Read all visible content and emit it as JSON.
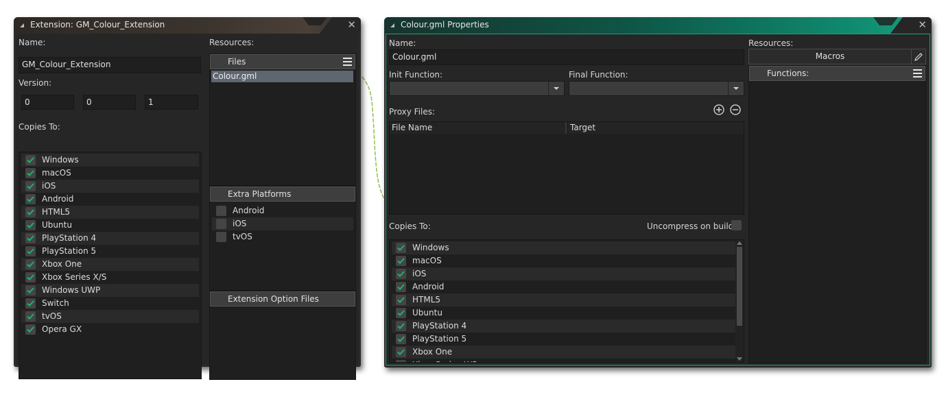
{
  "extension_window": {
    "title": "Extension: GM_Colour_Extension",
    "name_label": "Name:",
    "name_value": "GM_Colour_Extension",
    "version_label": "Version:",
    "version": [
      "0",
      "0",
      "1"
    ],
    "copies_to_label": "Copies To:",
    "copies_to": [
      {
        "label": "Windows",
        "checked": true
      },
      {
        "label": "macOS",
        "checked": true
      },
      {
        "label": "iOS",
        "checked": true
      },
      {
        "label": "Android",
        "checked": true
      },
      {
        "label": "HTML5",
        "checked": true
      },
      {
        "label": "Ubuntu",
        "checked": true
      },
      {
        "label": "PlayStation 4",
        "checked": true
      },
      {
        "label": "PlayStation 5",
        "checked": true
      },
      {
        "label": "Xbox One",
        "checked": true
      },
      {
        "label": "Xbox Series X/S",
        "checked": true
      },
      {
        "label": "Windows UWP",
        "checked": true
      },
      {
        "label": "Switch",
        "checked": true
      },
      {
        "label": "tvOS",
        "checked": true
      },
      {
        "label": "Opera GX",
        "checked": true
      }
    ],
    "resources_label": "Resources:",
    "files_header": "Files",
    "files": [
      "Colour.gml"
    ],
    "selected_file": "Colour.gml",
    "extra_platforms_header": "Extra Platforms",
    "extra_platforms": [
      {
        "label": "Android",
        "checked": false
      },
      {
        "label": "iOS",
        "checked": false
      },
      {
        "label": "tvOS",
        "checked": false
      }
    ],
    "extension_option_files_header": "Extension Option Files"
  },
  "properties_window": {
    "title": "Colour.gml Properties",
    "name_label": "Name:",
    "name_value": "Colour.gml",
    "init_function_label": "Init Function:",
    "init_function_value": "",
    "final_function_label": "Final Function:",
    "final_function_value": "",
    "proxy_files_label": "Proxy Files:",
    "proxy_columns": [
      "File Name",
      "Target"
    ],
    "copies_to_label": "Copies To:",
    "uncompress_label": "Uncompress on build",
    "uncompress_checked": false,
    "copies_to": [
      {
        "label": "Windows",
        "checked": true
      },
      {
        "label": "macOS",
        "checked": true
      },
      {
        "label": "iOS",
        "checked": true
      },
      {
        "label": "Android",
        "checked": true
      },
      {
        "label": "HTML5",
        "checked": true
      },
      {
        "label": "Ubuntu",
        "checked": true
      },
      {
        "label": "PlayStation 4",
        "checked": true
      },
      {
        "label": "PlayStation 5",
        "checked": true
      },
      {
        "label": "Xbox One",
        "checked": true
      },
      {
        "label": "Xbox Series X/S",
        "checked": true
      }
    ],
    "resources_label": "Resources:",
    "macros_button": "Macros",
    "functions_header": "Functions:"
  },
  "colors": {
    "check": "#1db36e",
    "accent_teal": "#1aa37f",
    "connector": "#8fbf4a"
  }
}
